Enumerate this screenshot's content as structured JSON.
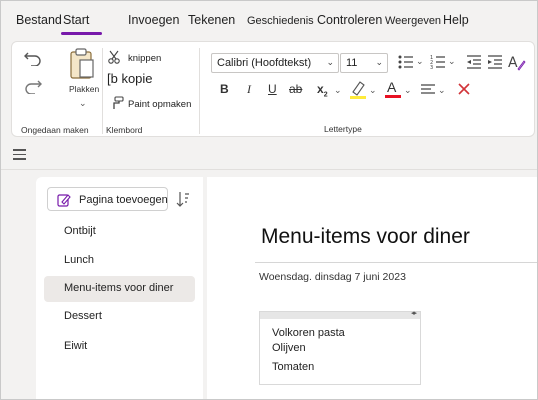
{
  "menu": {
    "items": [
      {
        "label": "Bestand"
      },
      {
        "label": "Start"
      },
      {
        "label": "Invoegen"
      },
      {
        "label": "Tekenen"
      },
      {
        "label": "Geschiedenis"
      },
      {
        "label": "Controleren"
      },
      {
        "label": "Weergeven"
      },
      {
        "label": "Help"
      }
    ],
    "active": "Start",
    "accent_color": "#7719aa"
  },
  "ribbon": {
    "undo": {
      "group_label": "Ongedaan maken",
      "undo_icon": "undo-icon",
      "redo_icon": "redo-icon"
    },
    "clipboard": {
      "group_label": "Klembord",
      "paste_label": "Plakken",
      "cut_label": "knippen",
      "copy_label": "[b kopie",
      "format_painter_label": "Paint opmaken"
    },
    "font": {
      "group_label": "Lettertype",
      "font_name": "Calibri (Hoofdtekst)",
      "font_size": "11",
      "bold_label": "B",
      "italic_label": "I",
      "underline_label": "U",
      "strikethrough_label": "ab",
      "subscript_label": "x",
      "subscript_sub": "2",
      "font_color_label": "A",
      "highlight_color": "#ffeb3b",
      "font_color": "#e81123",
      "clear_color": "#d13438"
    }
  },
  "pages": {
    "add_page_label": "Pagina toevoegen",
    "items": [
      {
        "label": "Ontbijt"
      },
      {
        "label": "Lunch"
      },
      {
        "label": "Menu-items voor diner"
      },
      {
        "label": "Dessert"
      },
      {
        "label": "Eiwit"
      }
    ],
    "selected": "Menu-items voor diner"
  },
  "page": {
    "title": "Menu-items voor diner",
    "date": "Woensdag. dinsdag 7 juni 2023",
    "note_lines": [
      "Volkoren pasta",
      "Olijven",
      "Tomaten"
    ]
  }
}
